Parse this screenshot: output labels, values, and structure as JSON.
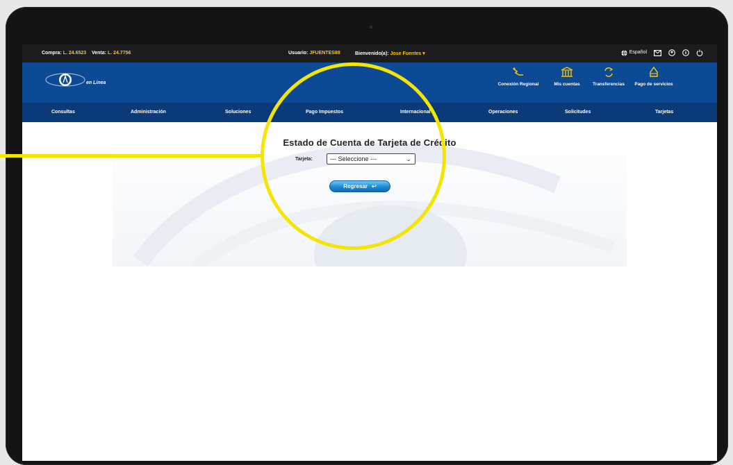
{
  "topbar": {
    "compra_label": "Compra:",
    "compra_value": "L. 24.6523",
    "venta_label": "Venta:",
    "venta_value": "L. 24.7756",
    "usuario_label": "Usuario:",
    "usuario_value": "JFUENTES88",
    "bienvenido_label": "Bienvenido(a):",
    "bienvenido_value": "Jose Fuentes",
    "language": "Español",
    "icons": [
      "globe-icon",
      "mail-icon",
      "support-icon",
      "help-icon",
      "power-icon"
    ]
  },
  "header": {
    "logo_text": "en Línea",
    "actions": [
      {
        "label": "Conexión Regional",
        "icon": "regional-icon"
      },
      {
        "label": "Mis cuentas",
        "icon": "bank-icon"
      },
      {
        "label": "Transferencias",
        "icon": "transfer-icon"
      },
      {
        "label": "Pago de servicios",
        "icon": "payment-icon"
      }
    ]
  },
  "nav": {
    "items": [
      "Consultas",
      "Administración",
      "Soluciones",
      "Pago Impuestos",
      "Internacional",
      "Operaciones",
      "Solicitudes",
      "Tarjetas"
    ]
  },
  "main": {
    "title": "Estado de Cuenta de Tarjeta de Crédito",
    "card_label": "Tarjeta:",
    "card_select_value": "--- Seleccione ---",
    "back_button": "Regresar"
  },
  "colors": {
    "header_blue": "#0d4a96",
    "nav_blue": "#0b3a78",
    "accent_yellow": "#f6c800",
    "highlight_yellow": "#f4e600"
  }
}
